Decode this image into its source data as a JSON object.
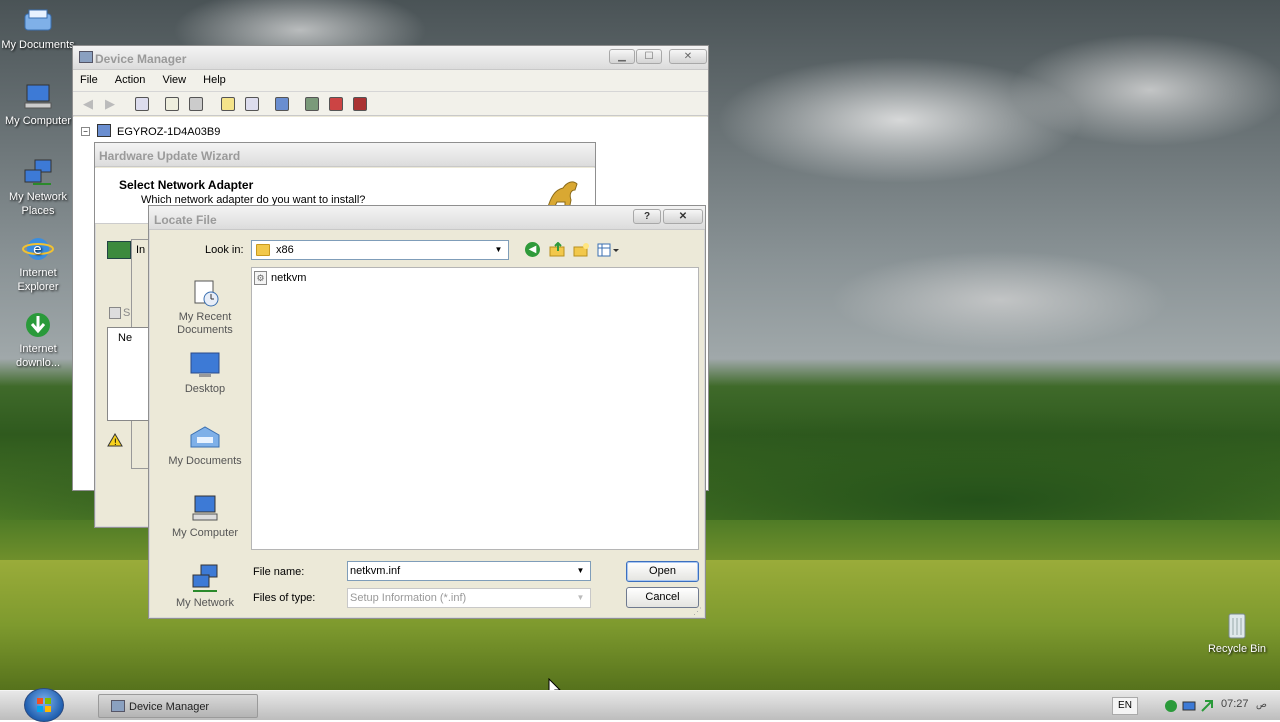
{
  "desktop": {
    "icons": [
      {
        "label": "My Documents",
        "icon": "my-documents-icon"
      },
      {
        "label": "My Computer",
        "icon": "my-computer-icon"
      },
      {
        "label": "My Network Places",
        "icon": "network-places-icon"
      },
      {
        "label": "Internet Explorer",
        "icon": "internet-explorer-icon"
      },
      {
        "label": "Internet downlo...",
        "icon": "internet-download-manager-icon"
      }
    ],
    "recycle_bin": "Recycle Bin"
  },
  "device_manager": {
    "title": "Device Manager",
    "menu": [
      "File",
      "Action",
      "View",
      "Help"
    ],
    "tree_root": "EGYROZ-1D4A03B9"
  },
  "wizard": {
    "title": "Hardware Update Wizard",
    "heading": "Select Network Adapter",
    "subheading": "Which network adapter do you want to install?",
    "frag_in": "In",
    "frag_s": "S",
    "frag_ne": "Ne"
  },
  "locate_file": {
    "title": "Locate File",
    "look_in_label": "Look in:",
    "look_in_value": "x86",
    "places": [
      "My Recent Documents",
      "Desktop",
      "My Documents",
      "My Computer",
      "My Network"
    ],
    "files": [
      {
        "name": "netkvm",
        "icon": "setup-info-file-icon"
      }
    ],
    "file_name_label": "File name:",
    "file_name_value": "netkvm.inf",
    "file_type_label": "Files of type:",
    "file_type_value": "Setup Information (*.inf)",
    "open_button": "Open",
    "cancel_button": "Cancel",
    "help_button": "?",
    "close_button": "✕"
  },
  "taskbar": {
    "task": "Device Manager",
    "language": "EN",
    "clock": "07:27",
    "clock_suffix": "ص"
  },
  "colors": {
    "accent": "#3c6fbe",
    "folder_yellow": "#f2c84b",
    "title_inactive": "#9a9a9a"
  }
}
